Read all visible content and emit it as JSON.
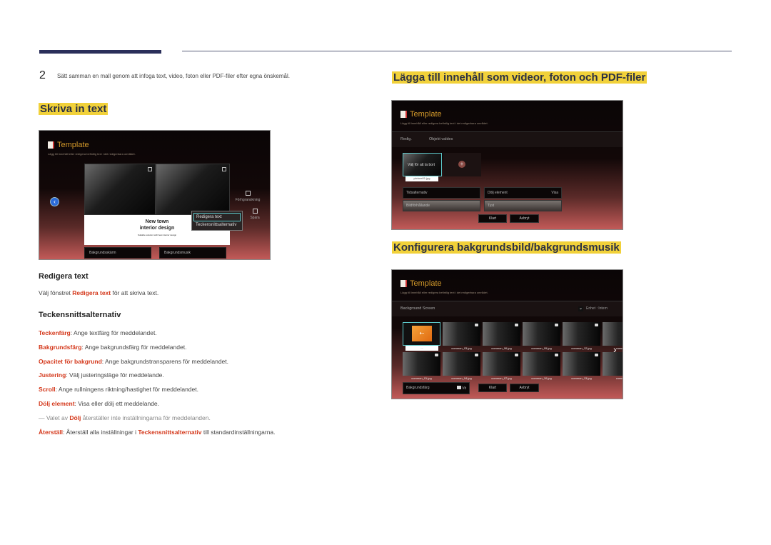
{
  "step": {
    "number": "2",
    "text": "Sätt samman en mall genom att infoga text, video, foton eller PDF-filer efter egna önskemål."
  },
  "sections": {
    "skriva": "Skriva in text",
    "lagga": "Lägga till innehåll som videor, foton och PDF-filer",
    "konfigurera": "Konfigurera bakgrundsbild/bakgrundsmusik"
  },
  "screen1": {
    "title": "Template",
    "subtitle": "Lägg till innehåll eller redigera befintlig text i det redigerbara området.",
    "card_line1": "New town",
    "card_line2": "interior design",
    "card_small": "Suitable solution with best interior design",
    "popup": [
      "Redigera text",
      "Teckensnittsalternativ"
    ],
    "preview_label": "Förhgranskning",
    "save_label": "Spara",
    "bg_screen_btn": "Bakgrundsskärm",
    "bg_music_btn": "Bakgrundsmusik"
  },
  "text_section": {
    "redigera_heading": "Redigera text",
    "redigera_pre": "Välj fönstret ",
    "redigera_bold": "Redigera text",
    "redigera_post": " för att skriva text.",
    "teckensnitt_heading": "Teckensnittsalternativ",
    "items": [
      {
        "term": "Teckenfärg",
        "desc": ": Ange textfärg för meddelandet."
      },
      {
        "term": "Bakgrundsfärg",
        "desc": ": Ange bakgrundsfärg för meddelandet."
      },
      {
        "term": "Opacitet för bakgrund",
        "desc": ": Ange bakgrundstransparens för meddelandet."
      },
      {
        "term": "Justering",
        "desc": ": Välj justeringsläge för meddelande."
      },
      {
        "term": "Scroll",
        "desc": ": Ange rullningens riktning/hastighet för meddelandet."
      },
      {
        "term": "Dölj element",
        "desc": ": Visa eller dölj ett meddelande."
      }
    ],
    "note_pre": "Valet av ",
    "note_bold": "Dölj",
    "note_post": " återställer inte inställningarna för meddelanden.",
    "reset_term": "Återställ",
    "reset_pre": ": Återställ alla inställningar i ",
    "reset_bold": "Teckensnittsalternativ",
    "reset_post": " till standardinställningarna."
  },
  "screen2": {
    "title": "Template",
    "subtitle": "Lägg till innehåll eller redigera befintlig text i det redigerbara området.",
    "tab_edit": "Redig.",
    "tab_object": "Objekt valdes",
    "tile_text": "Välj för att ta bort",
    "tile_file": "picture01.jpg",
    "fields": {
      "time": "Tidsalternativ",
      "hide": "Dölj element",
      "hide_value": "Visa",
      "ratio": "Bildförhållande",
      "mute": "Tyst"
    },
    "done": "Klart",
    "cancel": "Avbryt"
  },
  "screen3": {
    "title": "Template",
    "subtitle": "Lägg till innehåll eller redigera befintlig text i det redigerbara området.",
    "bg_label": "Background Screen",
    "device_label": "Enhet : Intern",
    "folder_caption": "...",
    "row1": [
      "common_03.jpg",
      "common_06.jpg",
      "common_09.jpg",
      "common_12.jpg",
      "common"
    ],
    "row2": [
      "common_01.jpg",
      "common_04.jpg",
      "common_07.jpg",
      "common_10.jpg",
      "common_13.jpg",
      "common"
    ],
    "bgcolor_label": "Bakgrundsfärg",
    "bgcolor_value": "Vit",
    "done": "Klart",
    "cancel": "Avbryt"
  }
}
